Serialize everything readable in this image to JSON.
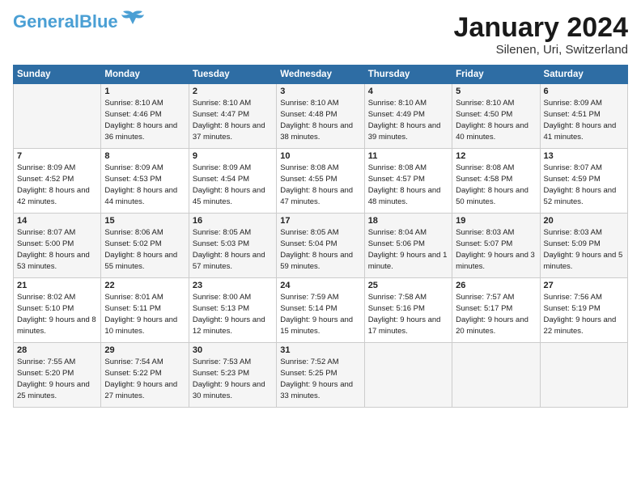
{
  "header": {
    "logo_line1": "General",
    "logo_line2": "Blue",
    "month": "January 2024",
    "location": "Silenen, Uri, Switzerland"
  },
  "weekdays": [
    "Sunday",
    "Monday",
    "Tuesday",
    "Wednesday",
    "Thursday",
    "Friday",
    "Saturday"
  ],
  "weeks": [
    [
      {
        "day": "",
        "sunrise": "",
        "sunset": "",
        "daylight": ""
      },
      {
        "day": "1",
        "sunrise": "Sunrise: 8:10 AM",
        "sunset": "Sunset: 4:46 PM",
        "daylight": "Daylight: 8 hours and 36 minutes."
      },
      {
        "day": "2",
        "sunrise": "Sunrise: 8:10 AM",
        "sunset": "Sunset: 4:47 PM",
        "daylight": "Daylight: 8 hours and 37 minutes."
      },
      {
        "day": "3",
        "sunrise": "Sunrise: 8:10 AM",
        "sunset": "Sunset: 4:48 PM",
        "daylight": "Daylight: 8 hours and 38 minutes."
      },
      {
        "day": "4",
        "sunrise": "Sunrise: 8:10 AM",
        "sunset": "Sunset: 4:49 PM",
        "daylight": "Daylight: 8 hours and 39 minutes."
      },
      {
        "day": "5",
        "sunrise": "Sunrise: 8:10 AM",
        "sunset": "Sunset: 4:50 PM",
        "daylight": "Daylight: 8 hours and 40 minutes."
      },
      {
        "day": "6",
        "sunrise": "Sunrise: 8:09 AM",
        "sunset": "Sunset: 4:51 PM",
        "daylight": "Daylight: 8 hours and 41 minutes."
      }
    ],
    [
      {
        "day": "7",
        "sunrise": "Sunrise: 8:09 AM",
        "sunset": "Sunset: 4:52 PM",
        "daylight": "Daylight: 8 hours and 42 minutes."
      },
      {
        "day": "8",
        "sunrise": "Sunrise: 8:09 AM",
        "sunset": "Sunset: 4:53 PM",
        "daylight": "Daylight: 8 hours and 44 minutes."
      },
      {
        "day": "9",
        "sunrise": "Sunrise: 8:09 AM",
        "sunset": "Sunset: 4:54 PM",
        "daylight": "Daylight: 8 hours and 45 minutes."
      },
      {
        "day": "10",
        "sunrise": "Sunrise: 8:08 AM",
        "sunset": "Sunset: 4:55 PM",
        "daylight": "Daylight: 8 hours and 47 minutes."
      },
      {
        "day": "11",
        "sunrise": "Sunrise: 8:08 AM",
        "sunset": "Sunset: 4:57 PM",
        "daylight": "Daylight: 8 hours and 48 minutes."
      },
      {
        "day": "12",
        "sunrise": "Sunrise: 8:08 AM",
        "sunset": "Sunset: 4:58 PM",
        "daylight": "Daylight: 8 hours and 50 minutes."
      },
      {
        "day": "13",
        "sunrise": "Sunrise: 8:07 AM",
        "sunset": "Sunset: 4:59 PM",
        "daylight": "Daylight: 8 hours and 52 minutes."
      }
    ],
    [
      {
        "day": "14",
        "sunrise": "Sunrise: 8:07 AM",
        "sunset": "Sunset: 5:00 PM",
        "daylight": "Daylight: 8 hours and 53 minutes."
      },
      {
        "day": "15",
        "sunrise": "Sunrise: 8:06 AM",
        "sunset": "Sunset: 5:02 PM",
        "daylight": "Daylight: 8 hours and 55 minutes."
      },
      {
        "day": "16",
        "sunrise": "Sunrise: 8:05 AM",
        "sunset": "Sunset: 5:03 PM",
        "daylight": "Daylight: 8 hours and 57 minutes."
      },
      {
        "day": "17",
        "sunrise": "Sunrise: 8:05 AM",
        "sunset": "Sunset: 5:04 PM",
        "daylight": "Daylight: 8 hours and 59 minutes."
      },
      {
        "day": "18",
        "sunrise": "Sunrise: 8:04 AM",
        "sunset": "Sunset: 5:06 PM",
        "daylight": "Daylight: 9 hours and 1 minute."
      },
      {
        "day": "19",
        "sunrise": "Sunrise: 8:03 AM",
        "sunset": "Sunset: 5:07 PM",
        "daylight": "Daylight: 9 hours and 3 minutes."
      },
      {
        "day": "20",
        "sunrise": "Sunrise: 8:03 AM",
        "sunset": "Sunset: 5:09 PM",
        "daylight": "Daylight: 9 hours and 5 minutes."
      }
    ],
    [
      {
        "day": "21",
        "sunrise": "Sunrise: 8:02 AM",
        "sunset": "Sunset: 5:10 PM",
        "daylight": "Daylight: 9 hours and 8 minutes."
      },
      {
        "day": "22",
        "sunrise": "Sunrise: 8:01 AM",
        "sunset": "Sunset: 5:11 PM",
        "daylight": "Daylight: 9 hours and 10 minutes."
      },
      {
        "day": "23",
        "sunrise": "Sunrise: 8:00 AM",
        "sunset": "Sunset: 5:13 PM",
        "daylight": "Daylight: 9 hours and 12 minutes."
      },
      {
        "day": "24",
        "sunrise": "Sunrise: 7:59 AM",
        "sunset": "Sunset: 5:14 PM",
        "daylight": "Daylight: 9 hours and 15 minutes."
      },
      {
        "day": "25",
        "sunrise": "Sunrise: 7:58 AM",
        "sunset": "Sunset: 5:16 PM",
        "daylight": "Daylight: 9 hours and 17 minutes."
      },
      {
        "day": "26",
        "sunrise": "Sunrise: 7:57 AM",
        "sunset": "Sunset: 5:17 PM",
        "daylight": "Daylight: 9 hours and 20 minutes."
      },
      {
        "day": "27",
        "sunrise": "Sunrise: 7:56 AM",
        "sunset": "Sunset: 5:19 PM",
        "daylight": "Daylight: 9 hours and 22 minutes."
      }
    ],
    [
      {
        "day": "28",
        "sunrise": "Sunrise: 7:55 AM",
        "sunset": "Sunset: 5:20 PM",
        "daylight": "Daylight: 9 hours and 25 minutes."
      },
      {
        "day": "29",
        "sunrise": "Sunrise: 7:54 AM",
        "sunset": "Sunset: 5:22 PM",
        "daylight": "Daylight: 9 hours and 27 minutes."
      },
      {
        "day": "30",
        "sunrise": "Sunrise: 7:53 AM",
        "sunset": "Sunset: 5:23 PM",
        "daylight": "Daylight: 9 hours and 30 minutes."
      },
      {
        "day": "31",
        "sunrise": "Sunrise: 7:52 AM",
        "sunset": "Sunset: 5:25 PM",
        "daylight": "Daylight: 9 hours and 33 minutes."
      },
      {
        "day": "",
        "sunrise": "",
        "sunset": "",
        "daylight": ""
      },
      {
        "day": "",
        "sunrise": "",
        "sunset": "",
        "daylight": ""
      },
      {
        "day": "",
        "sunrise": "",
        "sunset": "",
        "daylight": ""
      }
    ]
  ]
}
